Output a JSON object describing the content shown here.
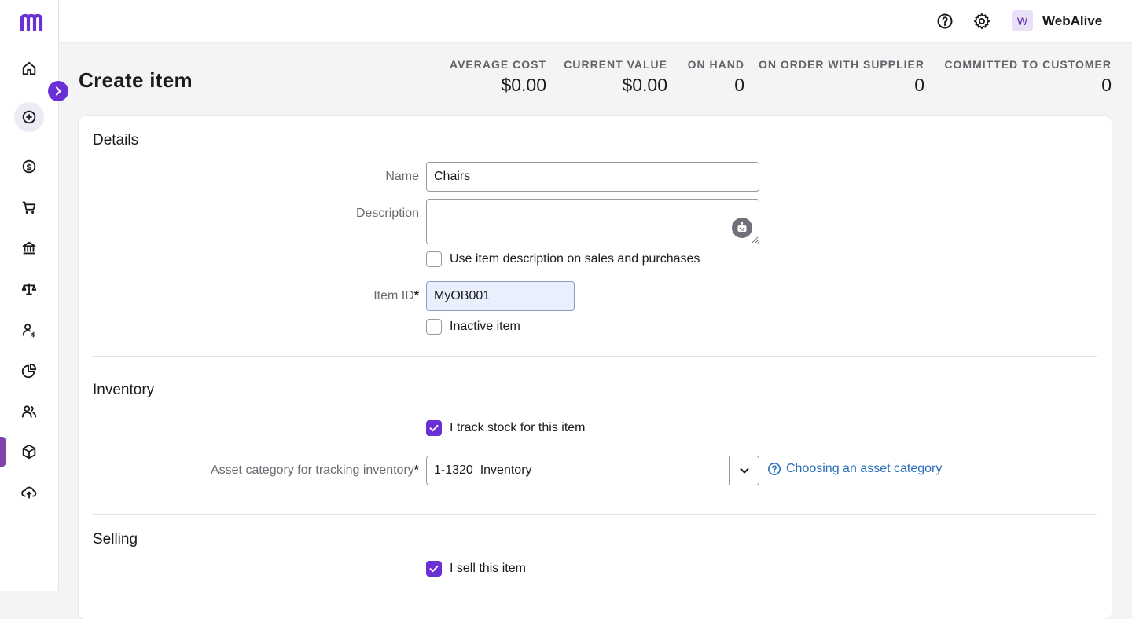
{
  "header": {
    "business_name": "WebAlive",
    "avatar_initial": "W"
  },
  "page": {
    "title": "Create item"
  },
  "stats": [
    {
      "label": "AVERAGE COST",
      "value": "$0.00"
    },
    {
      "label": "CURRENT VALUE",
      "value": "$0.00"
    },
    {
      "label": "ON HAND",
      "value": "0"
    },
    {
      "label": "ON ORDER WITH SUPPLIER",
      "value": "0"
    },
    {
      "label": "COMMITTED TO CUSTOMER",
      "value": "0"
    }
  ],
  "details": {
    "title": "Details",
    "name_label": "Name",
    "name_value": "Chairs",
    "description_label": "Description",
    "description_value": "",
    "use_description_label": "Use item description on sales and purchases",
    "item_id_label": "Item ID",
    "item_id_value": "MyOB001",
    "inactive_label": "Inactive item",
    "required_mark": "*"
  },
  "inventory": {
    "title": "Inventory",
    "track_stock_label": "I track stock for this item",
    "asset_category_label": "Asset category for tracking inventory",
    "asset_category_value": "1-1320  Inventory",
    "help_link": "Choosing an asset category"
  },
  "selling": {
    "title": "Selling",
    "sell_label": "I sell this item"
  },
  "colors": {
    "brand": "#6b2fd6",
    "active_nav": "#8241aa",
    "link": "#2a6ebb"
  },
  "icons": {
    "nav": [
      "home-icon",
      "create-icon",
      "sales-icon",
      "purchases-icon",
      "banking-icon",
      "accounting-icon",
      "payroll-icon",
      "reports-icon",
      "contacts-icon",
      "inventory-icon",
      "upload-icon"
    ]
  }
}
